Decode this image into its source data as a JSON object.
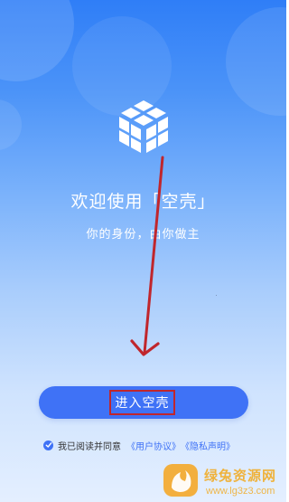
{
  "welcome": {
    "title": "欢迎使用「空壳」",
    "subtitle": "你的身份，由你做主"
  },
  "enter_button": {
    "label": "进入空壳"
  },
  "agreement": {
    "checked": true,
    "text": "我已阅读并同意",
    "user_agreement": "《用户协议》",
    "privacy_policy": "《隐私声明》"
  },
  "watermark": {
    "name": "绿兔资源网",
    "domain": "www.lg3z3.com"
  },
  "colors": {
    "accent": "#3f72f6",
    "annotation": "#c0262c",
    "watermark": "#f2a81a"
  },
  "icons": {
    "logo": "cube-logo-icon",
    "checkbox": "check-icon",
    "watermark": "flame-logo-icon"
  }
}
